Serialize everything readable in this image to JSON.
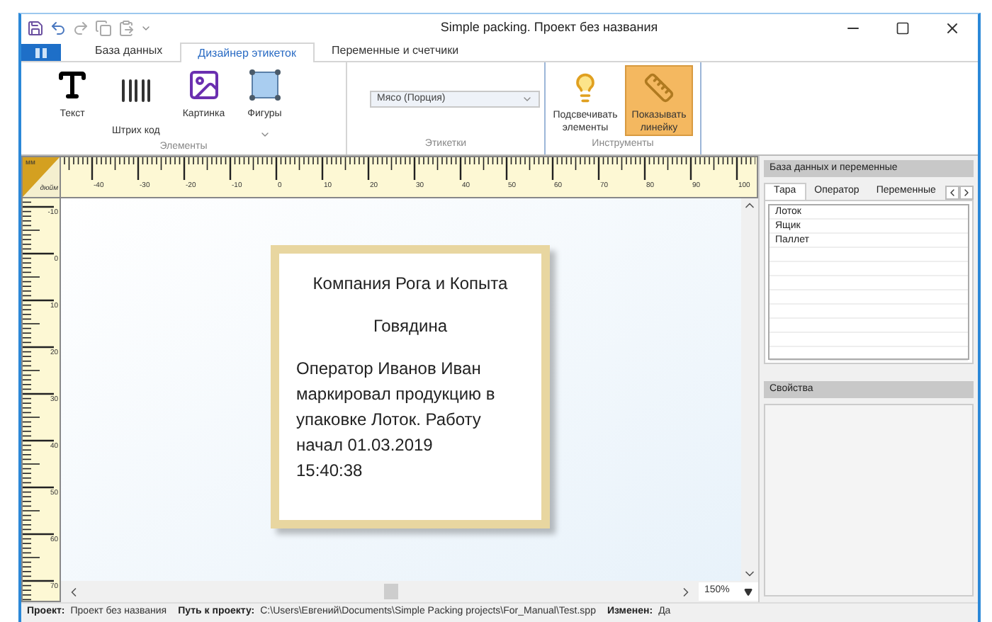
{
  "window": {
    "title": "Simple packing. Проект без названия"
  },
  "ribbon_tabs": [
    {
      "label": "База данных",
      "selected": false
    },
    {
      "label": "Дизайнер этикеток",
      "selected": true
    },
    {
      "label": "Переменные и счетчики",
      "selected": false
    }
  ],
  "elements_group": {
    "title": "Элементы",
    "items": [
      {
        "kind": "text",
        "label": "Текст"
      },
      {
        "kind": "barcode",
        "label": "Штрих код"
      },
      {
        "kind": "picture",
        "label": "Картинка"
      },
      {
        "kind": "shapes",
        "label": "Фигуры"
      }
    ]
  },
  "labels_group": {
    "title": "Этикетки",
    "combo_value": "Мясо (Порция)"
  },
  "tools_group": {
    "title": "Инструменты",
    "items": [
      {
        "kind": "highlight",
        "label": "Подсвечивать элементы",
        "selected": false
      },
      {
        "kind": "ruler",
        "label": "Показывать линейку",
        "selected": true
      }
    ]
  },
  "ruler": {
    "corner_top": "мм",
    "corner_bottom": "дюйм",
    "x_labels": [
      "-40",
      "-30",
      "-20",
      "-10",
      "0",
      "10",
      "20",
      "30",
      "40",
      "50",
      "60",
      "70",
      "80",
      "90",
      "100"
    ],
    "y_labels": [
      "-10",
      "0",
      "10",
      "20",
      "30",
      "40",
      "50",
      "60",
      "70"
    ]
  },
  "label_card": {
    "company": "Компания Рога и Копыта",
    "product": "Говядина",
    "message": "Оператор Иванов Иван маркировал продукцию в упаковке Лоток. Работу начал 01.03.2019 15:40:38"
  },
  "zoom": "150%",
  "right_panel": {
    "title": "База данных и переменные",
    "tabs": [
      {
        "label": "Тара",
        "selected": true
      },
      {
        "label": "Оператор",
        "selected": false
      },
      {
        "label": "Переменные",
        "selected": false
      }
    ],
    "items": [
      "Лоток",
      "Ящик",
      "Паллет"
    ],
    "properties_title": "Свойства"
  },
  "status_bar": [
    {
      "label": "Проект:",
      "value": "Проект без названия"
    },
    {
      "label": "Путь к проекту:",
      "value": "C:\\Users\\Евгений\\Documents\\Simple Packing projects\\For_Manual\\Test.spp"
    },
    {
      "label": "Изменен:",
      "value": "Да"
    }
  ]
}
